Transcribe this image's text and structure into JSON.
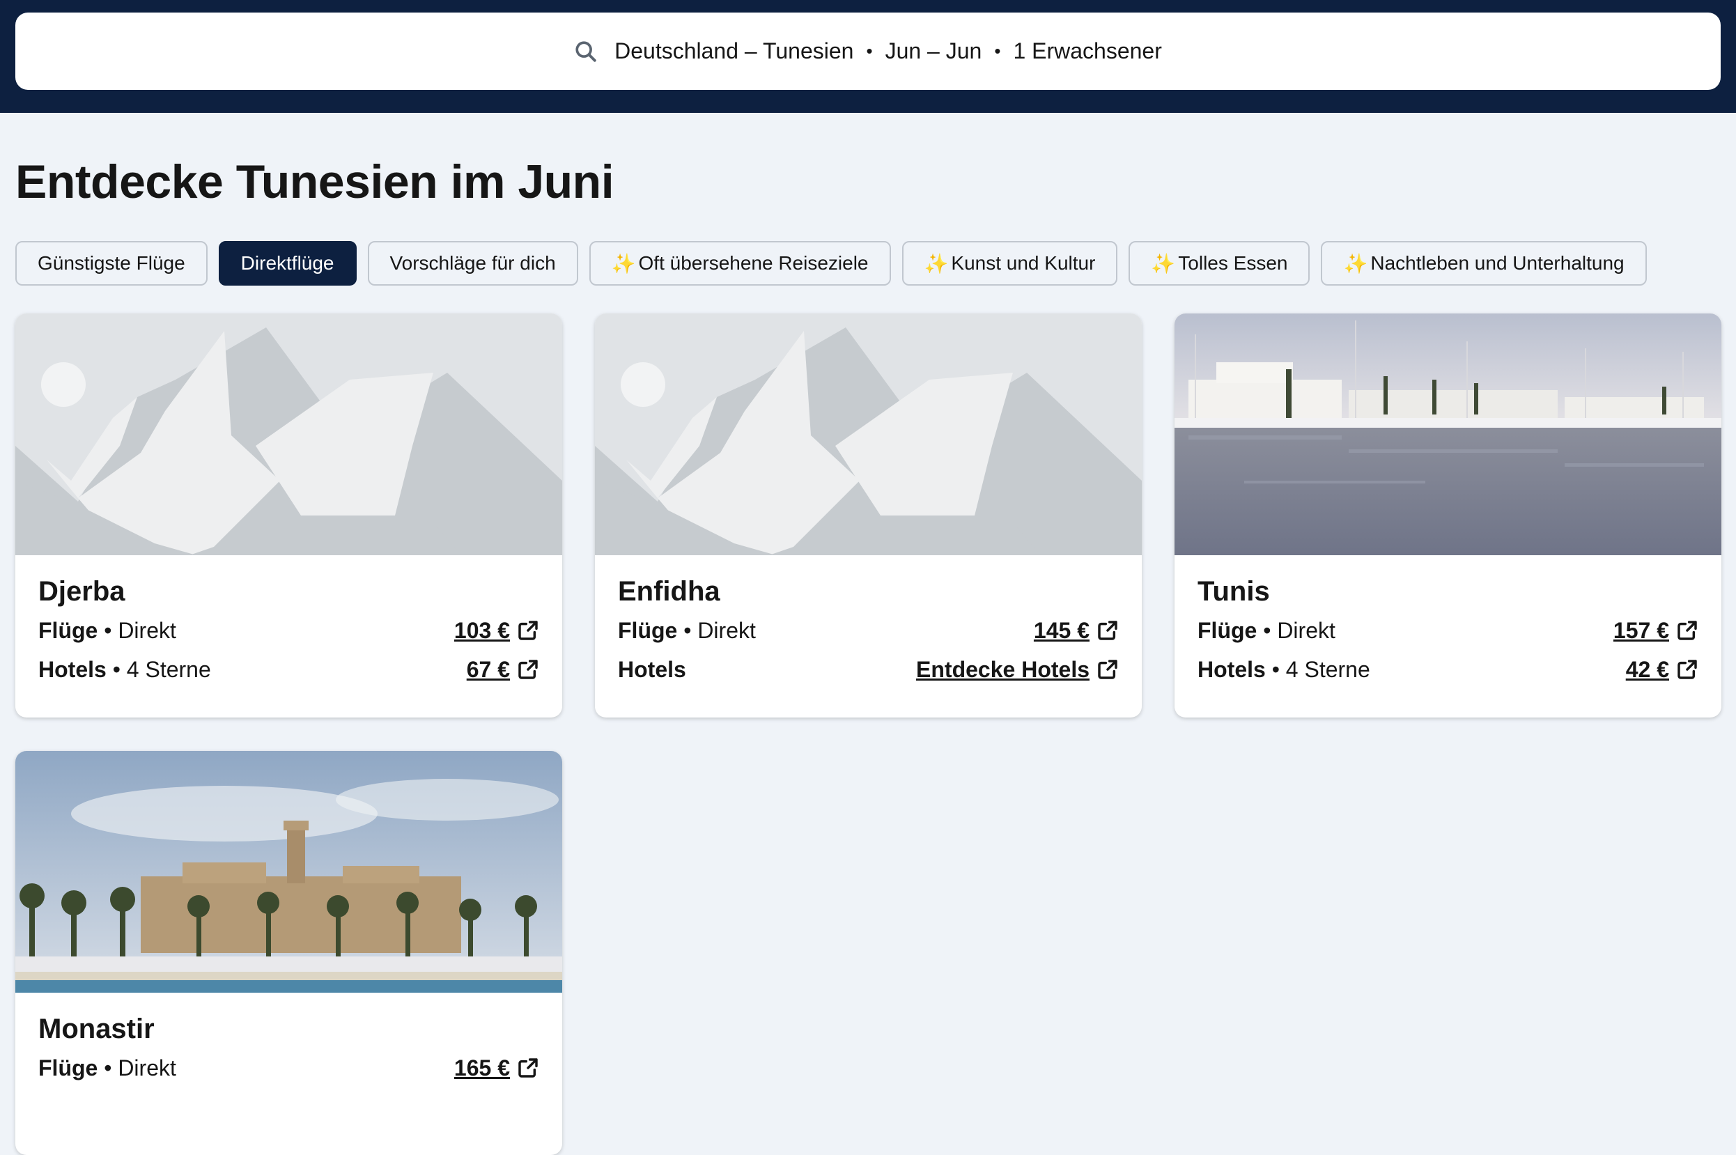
{
  "search": {
    "route": "Deutschland – Tunesien",
    "dates": "Jun – Jun",
    "travellers": "1 Erwachsener",
    "separator": "•"
  },
  "page_title": "Entdecke Tunesien im Juni",
  "filters": [
    {
      "label": "Günstigste Flüge",
      "active": false,
      "sparkle": false
    },
    {
      "label": "Direktflüge",
      "active": true,
      "sparkle": false
    },
    {
      "label": "Vorschläge für dich",
      "active": false,
      "sparkle": false
    },
    {
      "label": "Oft übersehene Reiseziele",
      "active": false,
      "sparkle": true
    },
    {
      "label": "Kunst und Kultur",
      "active": false,
      "sparkle": true
    },
    {
      "label": "Tolles Essen",
      "active": false,
      "sparkle": true
    },
    {
      "label": "Nachtleben und Unterhaltung",
      "active": false,
      "sparkle": true
    }
  ],
  "sparkle_glyph": "✨",
  "labels": {
    "flights": "Flüge",
    "hotels": "Hotels",
    "bullet": "•",
    "direct": "Direkt"
  },
  "destinations": [
    {
      "name": "Djerba",
      "image": "placeholder-mountains-icon",
      "flight_price": "103 €",
      "hotel_stars": "4 Sterne",
      "hotel_price": "67 €"
    },
    {
      "name": "Enfidha",
      "image": "placeholder-mountains-icon",
      "flight_price": "145 €",
      "hotel_stars": "",
      "hotel_price": "Entdecke Hotels"
    },
    {
      "name": "Tunis",
      "image": "harbour-photo",
      "flight_price": "157 €",
      "hotel_stars": "4 Sterne",
      "hotel_price": "42 €"
    },
    {
      "name": "Monastir",
      "image": "fortress-photo",
      "flight_price": "165 €",
      "hotel_stars": "",
      "hotel_price": ""
    }
  ],
  "colors": {
    "header_bg": "#0d2040",
    "page_bg": "#eff3f8",
    "active_chip": "#0d2040",
    "placeholder_bg": "#e0e3e6",
    "placeholder_mountain": "#c6cbcf"
  }
}
